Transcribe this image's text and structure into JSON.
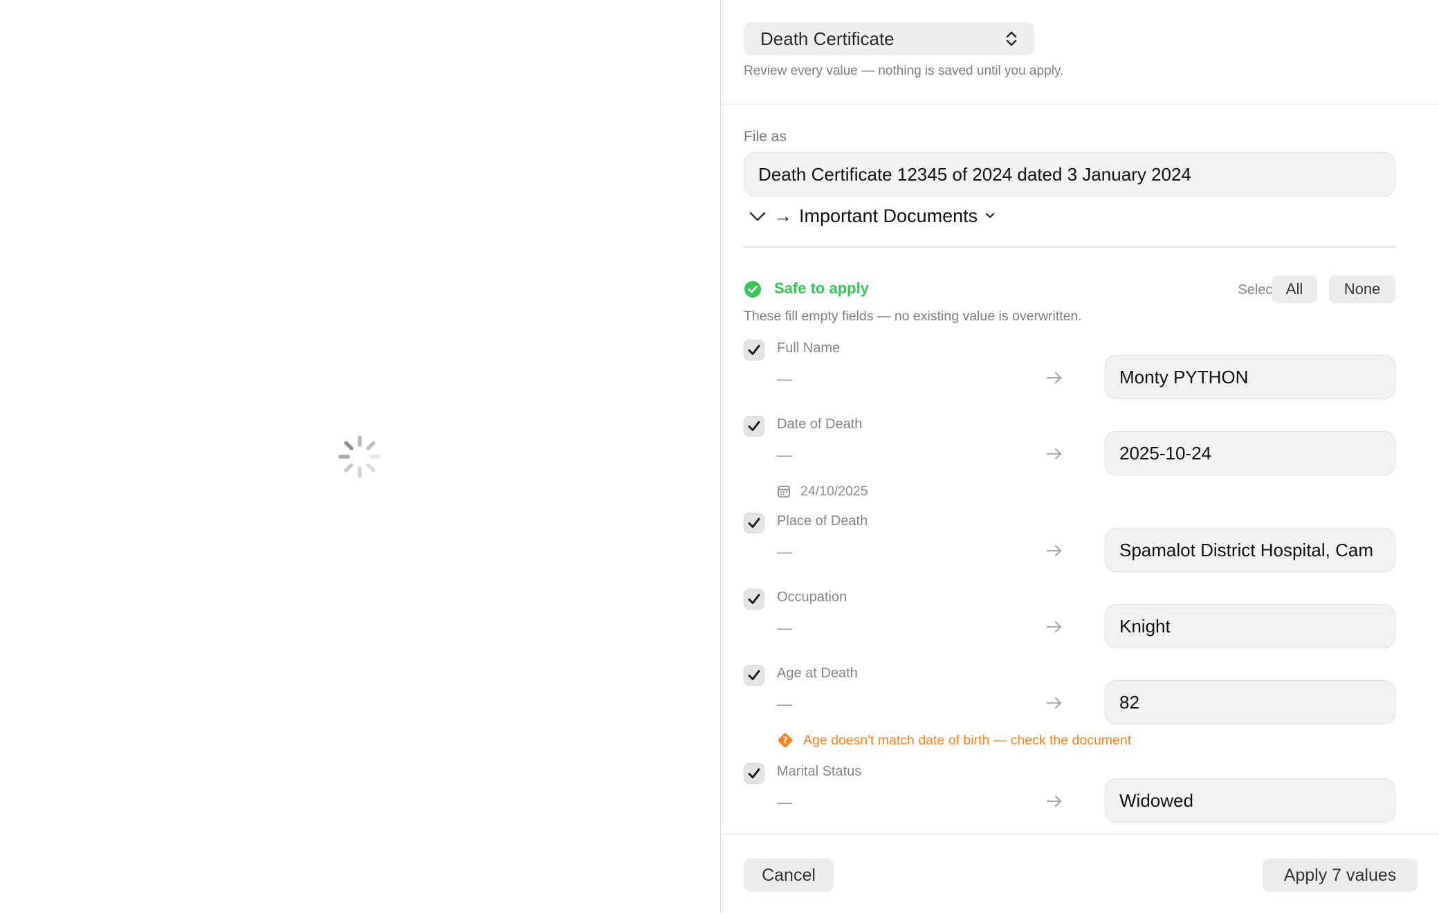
{
  "header": {
    "doc_type": "Death Certificate",
    "hint": "Review every value — nothing is saved until you apply."
  },
  "file_as": {
    "label": "File as",
    "value": "Death Certificate 12345 of 2024 dated 3 January 2024",
    "folder": "Important Documents",
    "folder_arrow": "→"
  },
  "safe": {
    "title": "Safe to apply",
    "select_label": "Select",
    "all_label": "All",
    "none_label": "None",
    "hint": "These fill empty fields — no existing value is overwritten.",
    "accent_color": "#34c759"
  },
  "fields": [
    {
      "label": "Full Name",
      "old": "—",
      "new": "Monty PYTHON",
      "checked": true
    },
    {
      "label": "Date of Death",
      "old": "—",
      "new": "2025-10-24",
      "checked": true,
      "note": "24/10/2025",
      "note_kind": "calendar-icon"
    },
    {
      "label": "Place of Death",
      "old": "—",
      "new": "Spamalot District Hospital, Cam",
      "checked": true
    },
    {
      "label": "Occupation",
      "old": "—",
      "new": "Knight",
      "checked": true
    },
    {
      "label": "Age at Death",
      "old": "—",
      "new": "82",
      "checked": true,
      "note": "Age doesn't match date of birth — check the document",
      "note_kind": "warning-icon"
    },
    {
      "label": "Marital Status",
      "old": "—",
      "new": "Widowed",
      "checked": true
    }
  ],
  "warning_color": "#f5841f",
  "footer": {
    "cancel_label": "Cancel",
    "apply_label": "Apply 7 values"
  }
}
